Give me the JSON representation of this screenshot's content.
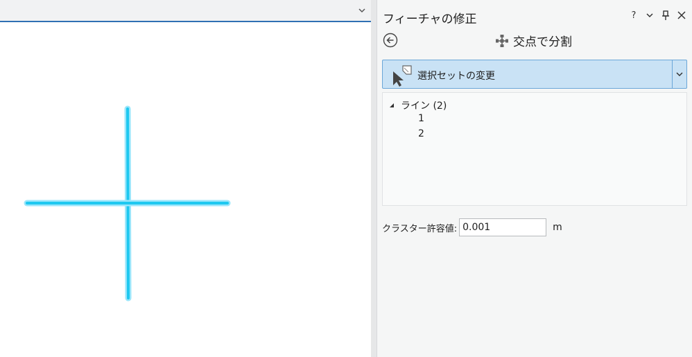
{
  "map": {
    "tabbar_chevron_icon": "chevron-down-icon",
    "feature_color": "#1ec8f0",
    "glow_color": "#9ae6fb"
  },
  "pane": {
    "title": "フィーチャの修正",
    "controls": {
      "help": "?",
      "menu_icon": "chevron-down-icon",
      "pin_icon": "pin-icon",
      "close_icon": "close-icon"
    },
    "back_icon": "back-arrow-icon",
    "tool": {
      "icon": "split-intersection-icon",
      "title": "交点で分割"
    },
    "selection_dropdown": {
      "icon": "selection-change-icon",
      "label": "選択セットの変更"
    },
    "tree": {
      "group_label": "ライン (2)",
      "items": [
        "1",
        "2"
      ]
    },
    "tolerance": {
      "label": "クラスター許容値:",
      "value": "0.001",
      "unit": "m"
    },
    "accent_color": "#c9e2f5"
  }
}
